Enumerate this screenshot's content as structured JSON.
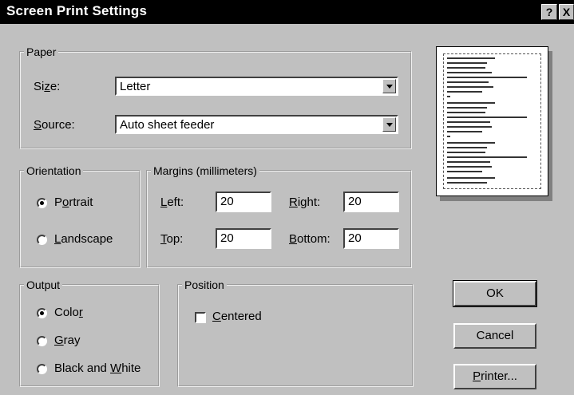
{
  "window": {
    "title": "Screen Print Settings",
    "help_label": "?",
    "close_label": "X"
  },
  "paper": {
    "group_label": "Paper",
    "size_label": "Size:",
    "size_value": "Letter",
    "source_label": "Source:",
    "source_value": "Auto sheet feeder"
  },
  "orientation": {
    "group_label": "Orientation",
    "portrait_label": "Portrait",
    "landscape_label": "Landscape",
    "selected": "Portrait"
  },
  "margins": {
    "group_label": "Margins (millimeters)",
    "left_label": "Left:",
    "left_value": "20",
    "right_label": "Right:",
    "right_value": "20",
    "top_label": "Top:",
    "top_value": "20",
    "bottom_label": "Bottom:",
    "bottom_value": "20"
  },
  "output": {
    "group_label": "Output",
    "color_label": "Color",
    "gray_label": "Gray",
    "bw_label": "Black and White",
    "selected": "Color"
  },
  "position": {
    "group_label": "Position",
    "centered_label": "Centered",
    "centered_checked": false
  },
  "buttons": {
    "ok": "OK",
    "cancel": "Cancel",
    "printer": "Printer..."
  }
}
